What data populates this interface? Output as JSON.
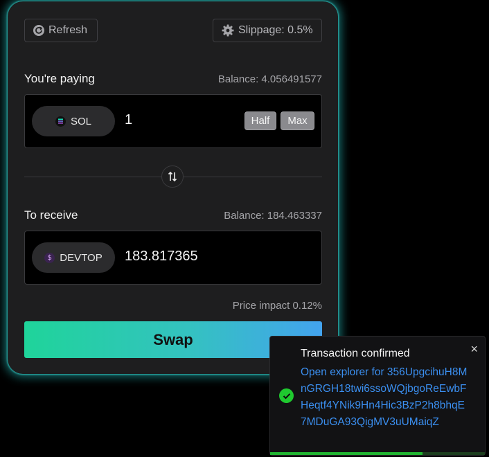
{
  "header": {
    "refresh_label": "Refresh",
    "slippage_label": "Slippage: 0.5%"
  },
  "pay": {
    "label": "You're paying",
    "balance": "Balance: 4.056491577",
    "token": "SOL",
    "amount": "1",
    "half_label": "Half",
    "max_label": "Max"
  },
  "receive": {
    "label": "To receive",
    "balance": "Balance: 184.463337",
    "token": "DEVTOP",
    "amount": "183.817365"
  },
  "price_impact": "Price impact 0.12%",
  "swap_label": "Swap",
  "toast": {
    "title": "Transaction confirmed",
    "link": "Open explorer for 356UpgcihuH8MnGRGH18twi6ssoWQjbgoReEwbFHeqtf4YNik9Hn4Hic3BzP2h8bhqE7MDuGA93QigMV3uUMaiqZ",
    "close": "×",
    "progress": 0.71
  },
  "colors": {
    "accent_start": "#1fd49a",
    "accent_end": "#43a3ee",
    "link": "#3b8ff0",
    "success": "#1fc92f"
  },
  "icons": [
    "refresh-icon",
    "gear-icon",
    "sol-logo-icon",
    "devtop-logo-icon",
    "swap-direction-icon",
    "check-circle-icon",
    "close-icon"
  ]
}
